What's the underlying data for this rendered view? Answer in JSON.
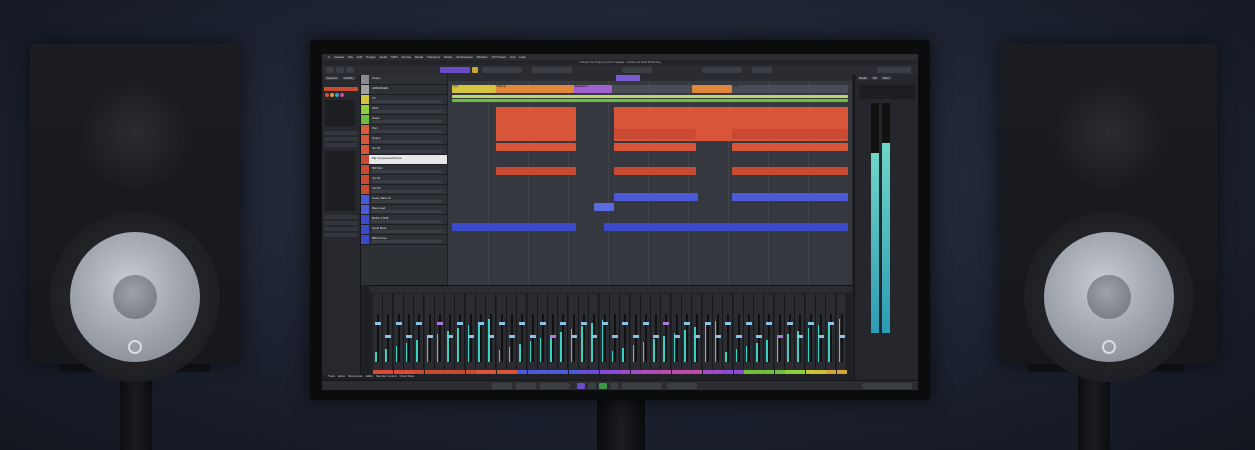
{
  "daw": {
    "menu": [
      "Cubase",
      "File",
      "Edit",
      "Project",
      "Audio",
      "MIDI",
      "Scores",
      "Media",
      "Transport",
      "Studio",
      "Workspaces",
      "Window",
      "VST Cloud",
      "Hub",
      "Help"
    ],
    "window_title": "Cubase Pro Project by Dom Sigalas - Cubase 14 Beta 3B Ending",
    "inspector_tabs": [
      "Inspector",
      "Visibility"
    ],
    "right_tabs": [
      "Media",
      "CR",
      "Meter"
    ],
    "bottom_tabs": [
      "Track",
      "Editor",
      "MixConsole",
      "Editor",
      "Sampler Control",
      "Chord Pads"
    ],
    "tracks": [
      {
        "name": "Tempo",
        "color": "#8a8a8a"
      },
      {
        "name": "ARRANGER",
        "color": "#a0a0a0"
      },
      {
        "name": "FX",
        "color": "#d4c33c"
      },
      {
        "name": "KICK",
        "color": "#8ecf3a"
      },
      {
        "name": "Snare",
        "color": "#6fbf3a"
      },
      {
        "name": "Perc",
        "color": "#d95d3a"
      },
      {
        "name": "Drums",
        "color": "#d9553a"
      },
      {
        "name": "Grv 01",
        "color": "#d9553a"
      },
      {
        "name": "Big Compressed Drums",
        "color": "#c84a32"
      },
      {
        "name": "808 Sub",
        "color": "#c84a32"
      },
      {
        "name": "Vox 01",
        "color": "#c84a32"
      },
      {
        "name": "Vox 02",
        "color": "#c84a32"
      },
      {
        "name": "Heavy Bass 01",
        "color": "#4a5ad8"
      },
      {
        "name": "Bass Lead",
        "color": "#4a5ad8"
      },
      {
        "name": "BASS 1 SUB",
        "color": "#3a4ac8"
      },
      {
        "name": "Synth Bass",
        "color": "#3a4ac8"
      },
      {
        "name": "808 Groove",
        "color": "#3a4ac8"
      }
    ],
    "arrangement_labels": [
      "Intro",
      "Build up",
      "Breakdown",
      "Drop"
    ],
    "colors": {
      "accent": "#7a5ad0",
      "meter": "#39d0c4",
      "fader": "#88c4e8"
    }
  }
}
